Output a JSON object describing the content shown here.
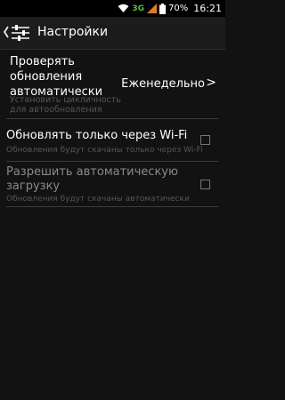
{
  "status_bar": {
    "network": "3G",
    "battery": "70%",
    "time": "16:21"
  },
  "header": {
    "title": "Настройки"
  },
  "settings": {
    "check_update": {
      "title": "Проверять обновления автоматически",
      "summary": "Установить цикличность для автообновления",
      "value": "Еженедельно",
      "arrow": ">"
    },
    "wifi_only": {
      "title": "Обновлять только через Wi-Fi",
      "summary": "Обновления будут скачаны только через Wi-Fi",
      "checked": false
    },
    "auto_download": {
      "title": "Разрешить автоматическую загрузку",
      "summary": "Обновления будут скачаны автоматически",
      "checked": false,
      "enabled": false
    }
  },
  "colors": {
    "background": "#121212",
    "text": "#ffffff",
    "summary": "#555555",
    "disabled": "#8a8a8a",
    "divider": "#3a3a3a",
    "signal_3g": "#5fbf3a"
  }
}
